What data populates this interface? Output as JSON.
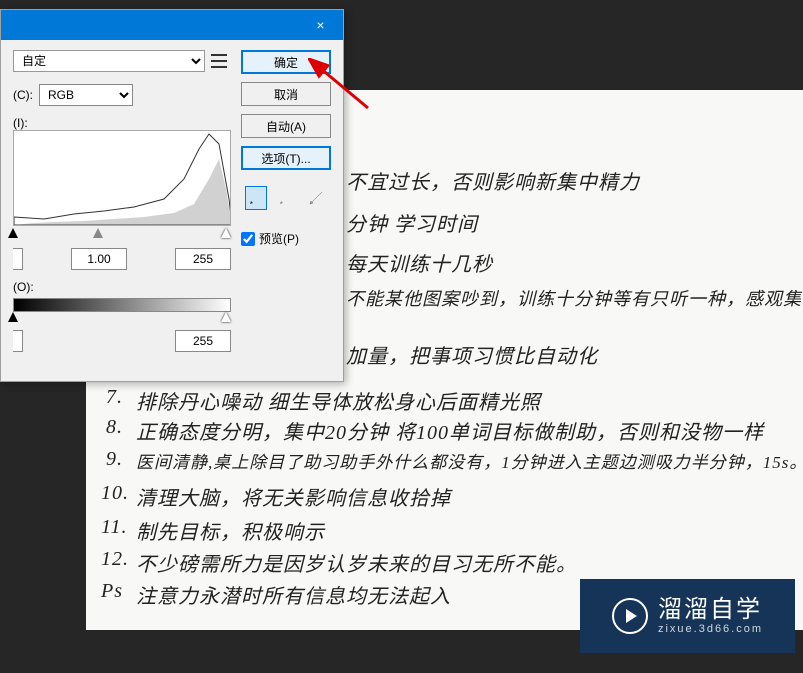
{
  "dialog": {
    "preset_value": "自定",
    "channel_label": "(C):",
    "channel_value": "RGB",
    "input_label": "(I):",
    "input_black": "",
    "input_mid": "1.00",
    "input_white": "255",
    "output_label": "(O):",
    "output_black": "",
    "output_white": "255",
    "ok": "确定",
    "cancel": "取消",
    "auto": "自动(A)",
    "options": "选项(T)...",
    "preview": "预览(P)",
    "close": "×"
  },
  "notes": {
    "l1": "不宜过长，否则影响新集中精力",
    "l2": "分钟 学习时间",
    "l3": "每天训练十几秒",
    "l4": "不能某他图案吵到，训练十分钟等有只听一种，感观集似",
    "l5": "加量，把事项习惯比自动化",
    "l7_num": "7.",
    "l7": "排除丹心噪动 细生导体放松身心后面精光照",
    "l8_num": "8.",
    "l8": "正确态度分明，集中20分钟 将100单词目标做制助，否则和没物一样",
    "l9_num": "9.",
    "l9": "医间清静,桌上除目了助习助手外什么都没有，1分钟进入主题边测吸力半分钟，15s。",
    "l10_num": "10.",
    "l10": "清理大脑，将无关影响信息收拾掉",
    "l11_num": "11.",
    "l11": "制先目标，积极响示",
    "l12_num": "12.",
    "l12": "不少磅需所力是因岁认岁未来的目习无所不能。",
    "l13_num": "Ps",
    "l13": "注意力永潜时所有信息均无法起入"
  },
  "watermark": {
    "main": "溜溜自学",
    "sub": "zixue.3d66.com"
  }
}
